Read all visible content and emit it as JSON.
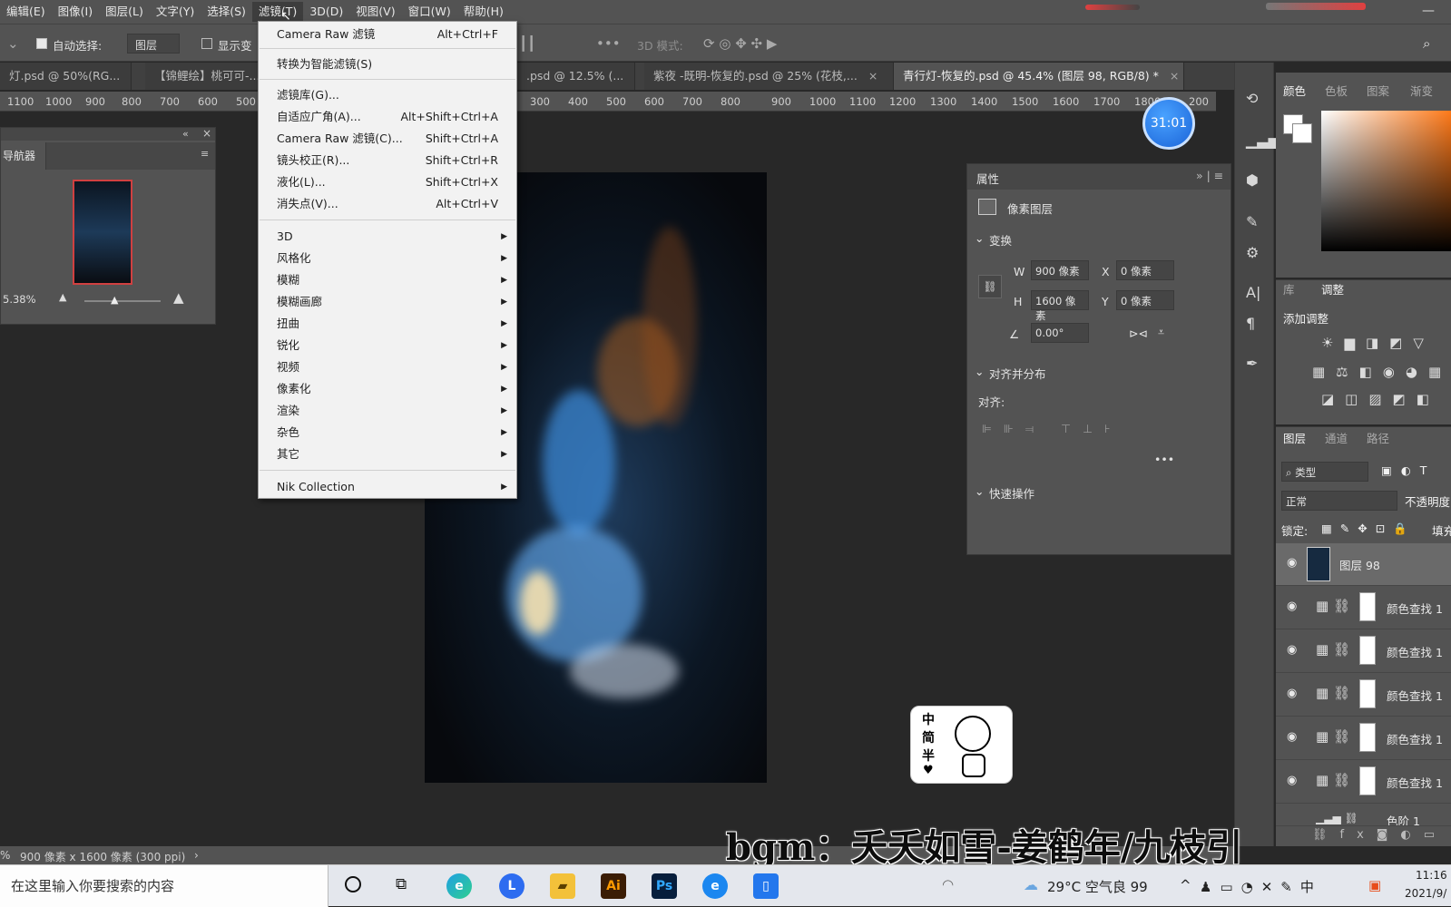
{
  "menubar": {
    "items": [
      "编辑(E)",
      "图像(I)",
      "图层(L)",
      "文字(Y)",
      "选择(S)",
      "滤镜(T)",
      "3D(D)",
      "视图(V)",
      "窗口(W)",
      "帮助(H)"
    ],
    "minimize": "—"
  },
  "options": {
    "auto_select_label": "自动选择:",
    "auto_select_value": "图层",
    "show_transform_label": "显示变",
    "mode_3d_label": "3D 模式:"
  },
  "tabs": [
    {
      "label": "灯.psd @ 50%(RG..."
    },
    {
      "label": "【锦鲤绘】桃可可-..."
    },
    {
      "label": ".psd @ 12.5% (..."
    },
    {
      "label": "紫夜 -既明-恢复的.psd @ 25% (花枝,..."
    },
    {
      "label": "青行灯-恢复的.psd @ 45.4% (图层 98, RGB/8) *"
    }
  ],
  "ruler": [
    "1100",
    "1000",
    "900",
    "800",
    "700",
    "600",
    "500",
    "300",
    "400",
    "500",
    "600",
    "700",
    "800",
    "900",
    "1000",
    "1100",
    "1200",
    "1300",
    "1400",
    "1500",
    "1600",
    "1700",
    "1800",
    "200"
  ],
  "navigator": {
    "title": "导航器",
    "zoom": "5.38%"
  },
  "filter_menu": {
    "items": [
      {
        "label": "Camera Raw 滤镜",
        "shortcut": "Alt+Ctrl+F"
      },
      {
        "label": "转换为智能滤镜(S)",
        "shortcut": ""
      },
      {
        "label": "滤镜库(G)...",
        "shortcut": ""
      },
      {
        "label": "自适应广角(A)...",
        "shortcut": "Alt+Shift+Ctrl+A"
      },
      {
        "label": "Camera Raw 滤镜(C)...",
        "shortcut": "Shift+Ctrl+A"
      },
      {
        "label": "镜头校正(R)...",
        "shortcut": "Shift+Ctrl+R"
      },
      {
        "label": "液化(L)...",
        "shortcut": "Shift+Ctrl+X"
      },
      {
        "label": "消失点(V)...",
        "shortcut": "Alt+Ctrl+V"
      },
      {
        "label": "3D",
        "shortcut": ""
      },
      {
        "label": "风格化",
        "shortcut": ""
      },
      {
        "label": "模糊",
        "shortcut": ""
      },
      {
        "label": "模糊画廊",
        "shortcut": ""
      },
      {
        "label": "扭曲",
        "shortcut": ""
      },
      {
        "label": "锐化",
        "shortcut": ""
      },
      {
        "label": "视频",
        "shortcut": ""
      },
      {
        "label": "像素化",
        "shortcut": ""
      },
      {
        "label": "渲染",
        "shortcut": ""
      },
      {
        "label": "杂色",
        "shortcut": ""
      },
      {
        "label": "其它",
        "shortcut": ""
      },
      {
        "label": "Nik Collection",
        "shortcut": ""
      }
    ]
  },
  "properties": {
    "title": "属性",
    "layer_type": "像素图层",
    "transform_label": "变换",
    "w_label": "W",
    "w_value": "900 像素",
    "x_label": "X",
    "x_value": "0 像素",
    "h_label": "H",
    "h_value": "1600 像素",
    "y_label": "Y",
    "y_value": "0 像素",
    "angle_value": "0.00°",
    "align_section": "对齐并分布",
    "align_label": "对齐:",
    "quick_actions": "快速操作"
  },
  "timer": "31:01",
  "color_panel": {
    "tabs": [
      "颜色",
      "色板",
      "图案",
      "渐变"
    ]
  },
  "adjust_panel": {
    "tabs": [
      "库",
      "调整"
    ],
    "add_label": "添加调整"
  },
  "layers_panel": {
    "tabs": [
      "图层",
      "通道",
      "路径"
    ],
    "filter_value": "类型",
    "blend_mode": "正常",
    "opacity_label": "不透明度",
    "lock_label": "锁定:",
    "fill_label": "填充",
    "layers": [
      "图层 98",
      "颜色查找 1",
      "颜色查找 1",
      "颜色查找 1",
      "颜色查找 1",
      "颜色查找 1",
      "色阶 1"
    ]
  },
  "status": {
    "zoom": "%",
    "doc_size": "900 像素 x 1600 像素 (300 ppi)"
  },
  "sticker_text": [
    "中",
    "简",
    "半"
  ],
  "bgm": "bgm：夭夭如雪-姜鹤年/九枝引",
  "taskbar": {
    "search_placeholder": "在这里输入你要搜索的内容",
    "weather": "29°C 空气良 99",
    "time": "11:16",
    "date": "2021/9/"
  }
}
